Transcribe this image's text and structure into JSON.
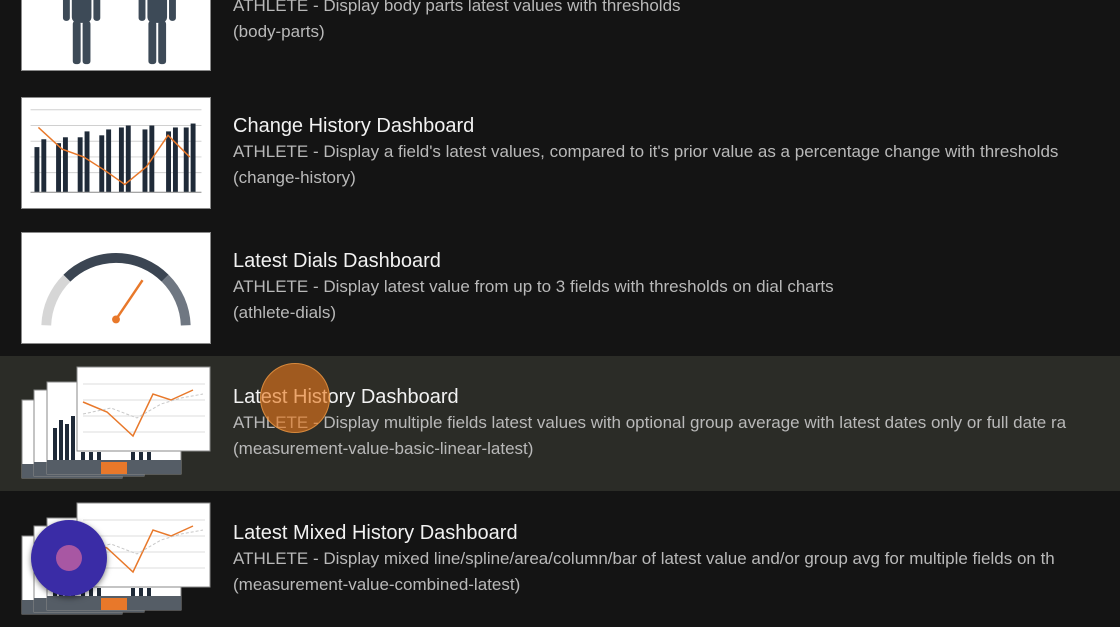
{
  "items": [
    {
      "title": "",
      "description": "ATHLETE - Display body parts latest values with thresholds",
      "code": "(body-parts)",
      "thumbnail_icon": "body-figures-icon"
    },
    {
      "title": "Change History Dashboard",
      "description": "ATHLETE - Display a field's latest values, compared to it's prior value as a percentage change with thresholds",
      "code": "(change-history)",
      "thumbnail_icon": "bar-line-chart-icon"
    },
    {
      "title": "Latest Dials Dashboard",
      "description": "ATHLETE - Display latest value from up to 3 fields with thresholds on dial charts",
      "code": "(athlete-dials)",
      "thumbnail_icon": "dial-gauge-icon"
    },
    {
      "title": "Latest History Dashboard",
      "description": "ATHLETE - Display multiple fields latest values with optional group average with latest dates only or full date ra",
      "code": "(measurement-value-basic-linear-latest)",
      "thumbnail_icon": "stacked-history-charts-icon",
      "selected": true
    },
    {
      "title": "Latest Mixed History Dashboard",
      "description": "ATHLETE - Display mixed line/spline/area/column/bar of latest value and/or group avg for multiple fields on th",
      "code": "(measurement-value-combined-latest)",
      "thumbnail_icon": "stacked-mixed-charts-icon"
    }
  ],
  "colors": {
    "background": "#141414",
    "selected_row": "#2b2c27",
    "accent_orange": "#e8782a",
    "fab": "#3a2ca6"
  },
  "floating_button_icon": "record-icon",
  "touch_indicator_icon": "touch-indicator-icon"
}
